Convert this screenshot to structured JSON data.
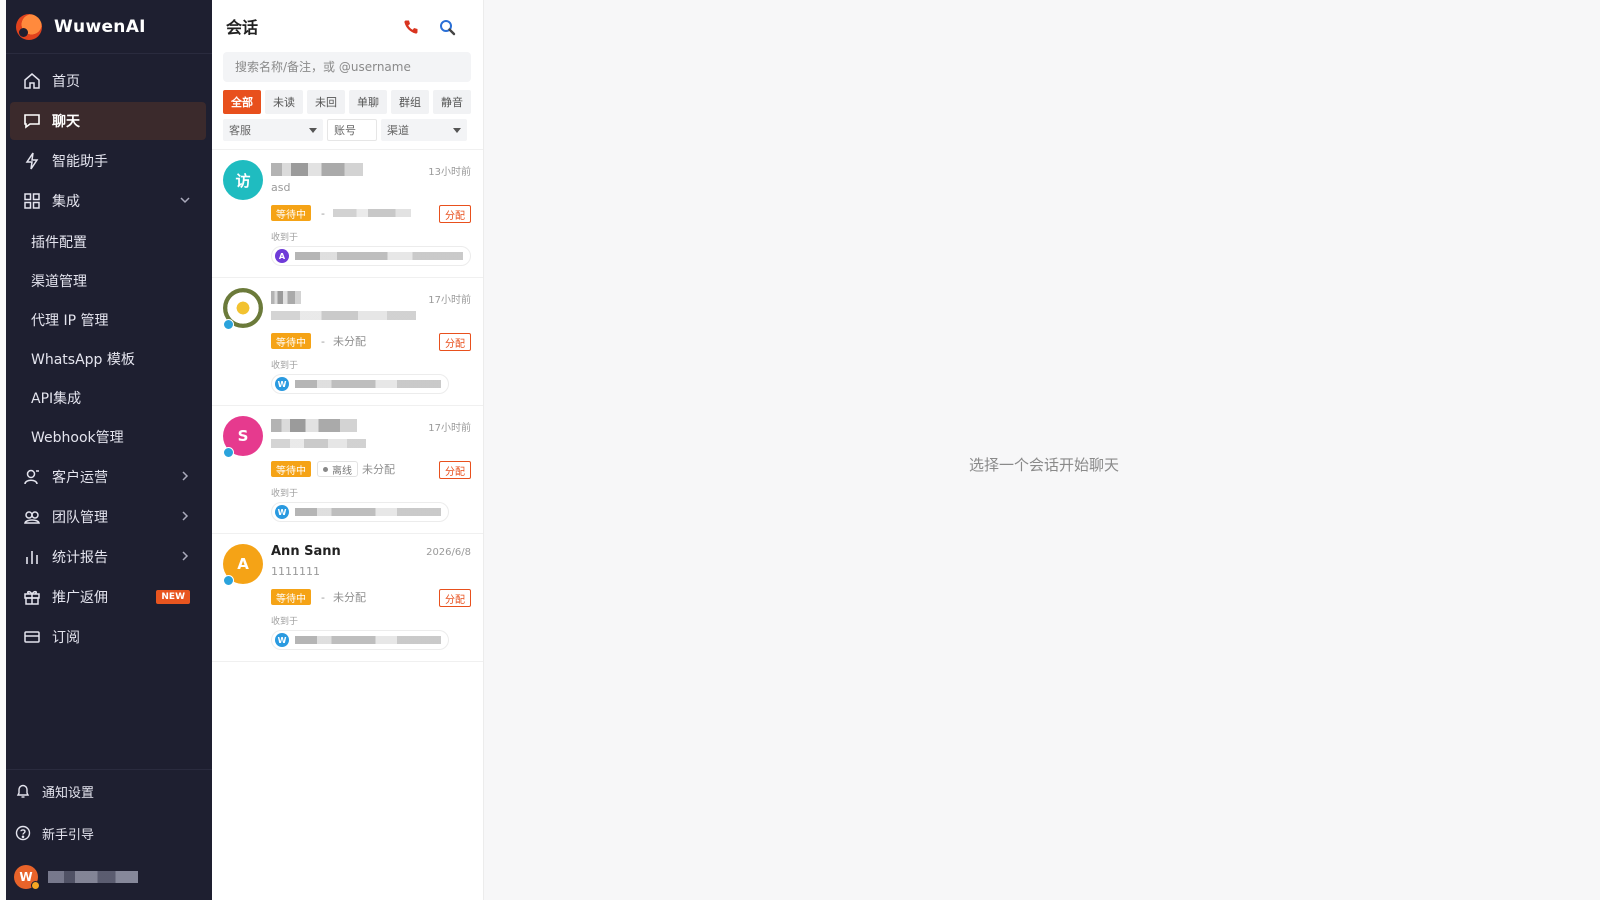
{
  "brand": {
    "name": "WuwenAI"
  },
  "sidebar": {
    "items": [
      {
        "label": "首页",
        "icon": "home-icon"
      },
      {
        "label": "聊天",
        "icon": "chat-icon",
        "active": true
      },
      {
        "label": "智能助手",
        "icon": "lightning-icon"
      },
      {
        "label": "集成",
        "icon": "grid-icon",
        "expanded": true
      }
    ],
    "sub_items": [
      {
        "label": "插件配置"
      },
      {
        "label": "渠道管理"
      },
      {
        "label": "代理 IP 管理"
      },
      {
        "label": "WhatsApp 模板"
      },
      {
        "label": "API集成"
      },
      {
        "label": "Webhook管理"
      }
    ],
    "more_items": [
      {
        "label": "客户运营",
        "icon": "user-icon"
      },
      {
        "label": "团队管理",
        "icon": "team-icon"
      },
      {
        "label": "统计报告",
        "icon": "bar-chart-icon"
      },
      {
        "label": "推广返佣",
        "icon": "gift-icon",
        "badge": "NEW"
      },
      {
        "label": "订阅",
        "icon": "card-icon"
      }
    ],
    "bottom": {
      "notify": "通知设置",
      "guide": "新手引导",
      "user_initial": "W"
    }
  },
  "conversations": {
    "title": "会话",
    "search_placeholder": "搜索名称/备注，或 @username",
    "tabs": [
      "全部",
      "未读",
      "未回",
      "单聊",
      "群组",
      "静音"
    ],
    "filters": {
      "agent": "客服",
      "account": "账号",
      "channel": "渠道"
    },
    "received_label": "收到于",
    "assign_label": "分配",
    "items": [
      {
        "avatar_text": "访",
        "avatar_color": "#1fbcc0",
        "name": "",
        "time": "13小时前",
        "preview": "asd",
        "status": "等待中",
        "assignee": "",
        "channel_icon": "A",
        "channel_color": "#6f3bd8"
      },
      {
        "avatar_text": "",
        "avatar_color": "#c9c19a",
        "name": "",
        "time": "17小时前",
        "preview": "",
        "status": "等待中",
        "assignee": "未分配",
        "channel_icon": "W",
        "channel_color": "#2a9ae0"
      },
      {
        "avatar_text": "S",
        "avatar_color": "#e63a8e",
        "name": "",
        "time": "17小时前",
        "preview": "",
        "status": "等待中",
        "offline": "离线",
        "assignee": "未分配",
        "channel_icon": "W",
        "channel_color": "#2a9ae0"
      },
      {
        "avatar_text": "A",
        "avatar_color": "#f5a316",
        "name": "Ann Sann",
        "time": "2026/6/8",
        "preview": "1111111",
        "status": "等待中",
        "assignee": "未分配",
        "channel_icon": "W",
        "channel_color": "#2a9ae0"
      }
    ]
  },
  "main": {
    "empty_text": "选择一个会话开始聊天"
  },
  "colors": {
    "accent": "#e8501d",
    "sidebar_bg": "#1e1f30",
    "status_wait": "#f5a316"
  }
}
